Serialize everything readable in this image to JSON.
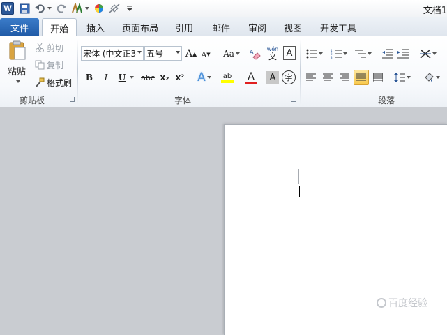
{
  "window": {
    "title": "文档1"
  },
  "tabs": {
    "file": "文件",
    "items": [
      "开始",
      "插入",
      "页面布局",
      "引用",
      "邮件",
      "审阅",
      "视图",
      "开发工具"
    ],
    "active": "开始"
  },
  "clipboard": {
    "paste": "粘贴",
    "cut": "剪切",
    "copy": "复制",
    "format_painter": "格式刷",
    "group_label": "剪贴板"
  },
  "font": {
    "font_name": "宋体 (中文正3",
    "font_size": "五号",
    "grow": "A",
    "shrink": "A",
    "change_case": "Aa",
    "phonetic": "wén",
    "bold": "B",
    "italic": "I",
    "underline": "U",
    "strikethrough": "abc",
    "subscript": "x₂",
    "superscript": "x²",
    "text_effects": "A",
    "highlight": "ab",
    "font_color": "A",
    "char_shading": "A",
    "enclose": "字",
    "group_label": "字体"
  },
  "paragraph": {
    "group_label": "段落"
  },
  "watermark": "百度经验",
  "colors": {
    "file_tab": "#2a65b4",
    "font_color_bar": "#e02020",
    "highlight_bar": "#ffff00",
    "accent_selected": "#f8c94c"
  }
}
